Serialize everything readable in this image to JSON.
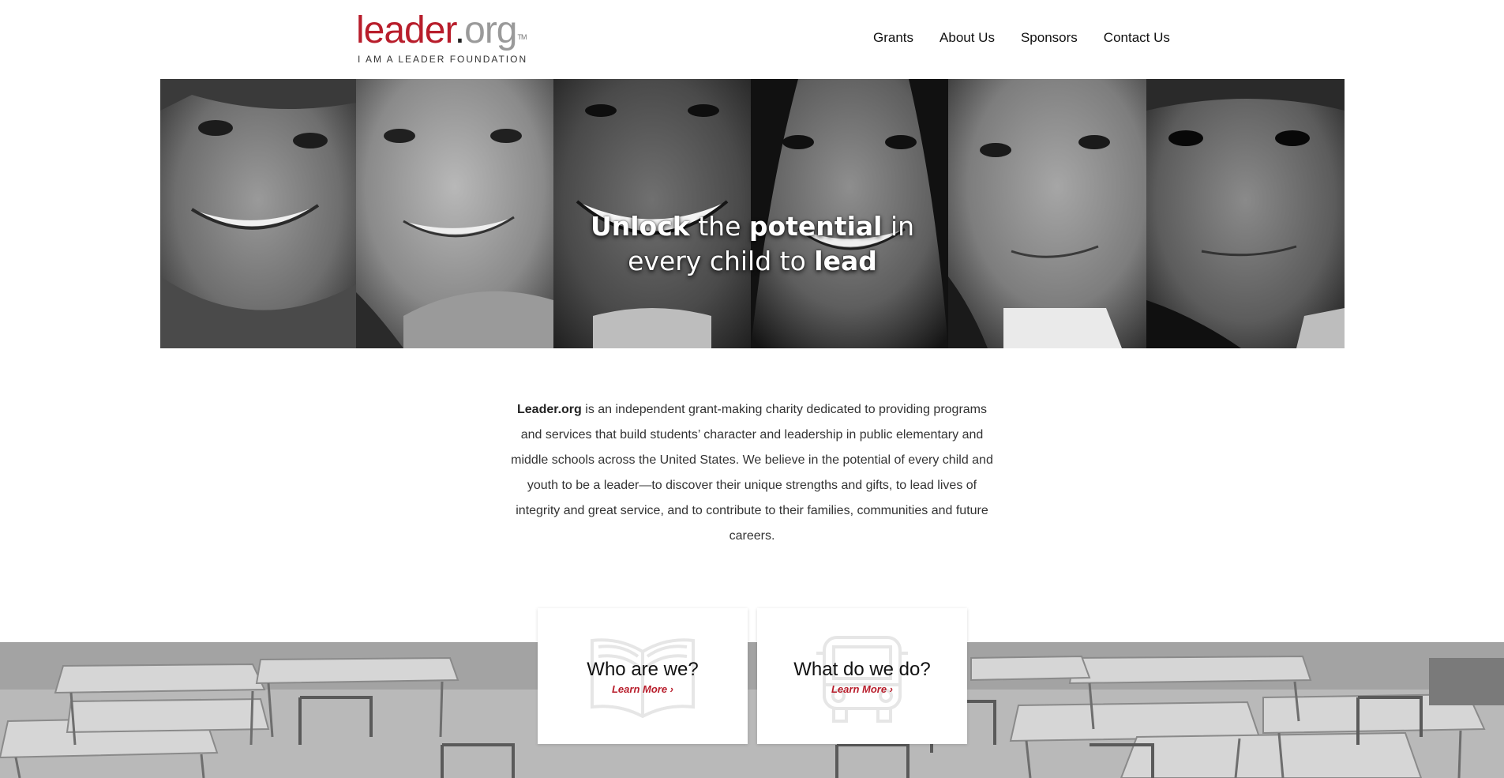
{
  "header": {
    "logo": {
      "main_red": "leader",
      "main_dot": ".",
      "main_gray": "org",
      "tm": "TM",
      "tagline": "I AM A LEADER FOUNDATION"
    },
    "nav": [
      "Grants",
      "About Us",
      "Sponsors",
      "Contact Us"
    ]
  },
  "hero": {
    "line1": {
      "b1": "Unlock",
      "t1": " the ",
      "b2": "potential",
      "t2": " in"
    },
    "line2": {
      "t1": "every child to ",
      "b1": "lead"
    }
  },
  "intro": {
    "org_name": "Leader.org",
    "text": " is an independent grant-making charity dedicated to providing programs and services that build students’ character and leadership in public elementary and middle schools across the United States. We believe in the potential of every child and youth to be a leader—to discover their unique strengths and gifts, to lead lives of integrity and great service, and to contribute to their families, communities and future careers."
  },
  "cards": [
    {
      "title": "Who are we?",
      "link": "Learn More ›",
      "icon": "open-book-icon"
    },
    {
      "title": "What do we do?",
      "link": "Learn More ›",
      "icon": "school-bus-icon"
    }
  ],
  "colors": {
    "brand_red": "#b81d2b",
    "logo_gray": "#9a9a9a"
  }
}
